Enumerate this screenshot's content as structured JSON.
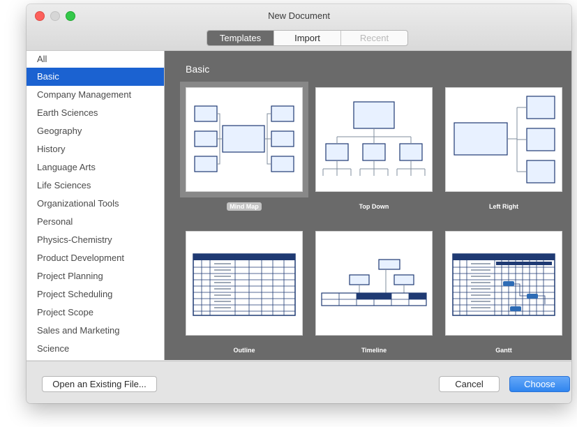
{
  "window": {
    "title": "New Document"
  },
  "tabs": [
    {
      "label": "Templates",
      "state": "active"
    },
    {
      "label": "Import",
      "state": "normal"
    },
    {
      "label": "Recent",
      "state": "disabled"
    }
  ],
  "sidebar": {
    "items": [
      {
        "label": "All"
      },
      {
        "label": "Basic",
        "selected": true
      },
      {
        "label": "Company Management"
      },
      {
        "label": "Earth Sciences"
      },
      {
        "label": "Geography"
      },
      {
        "label": "History"
      },
      {
        "label": "Language Arts"
      },
      {
        "label": "Life Sciences"
      },
      {
        "label": "Organizational Tools"
      },
      {
        "label": "Personal"
      },
      {
        "label": "Physics-Chemistry"
      },
      {
        "label": "Product Development"
      },
      {
        "label": "Project Planning"
      },
      {
        "label": "Project Scheduling"
      },
      {
        "label": "Project Scope"
      },
      {
        "label": "Sales and Marketing"
      },
      {
        "label": "Science"
      }
    ]
  },
  "gallery": {
    "section_title": "Basic",
    "templates": [
      {
        "label": "Mind Map",
        "selected": true
      },
      {
        "label": "Top Down"
      },
      {
        "label": "Left Right"
      },
      {
        "label": "Outline"
      },
      {
        "label": "Timeline"
      },
      {
        "label": "Gantt"
      }
    ]
  },
  "footer": {
    "open_label": "Open an Existing File...",
    "cancel_label": "Cancel",
    "choose_label": "Choose"
  },
  "colors": {
    "accent": "#1b62d1",
    "diagram_stroke": "#1f3a73",
    "diagram_fill": "#e8f1ff",
    "gallery_bg": "#6a6a6a"
  }
}
